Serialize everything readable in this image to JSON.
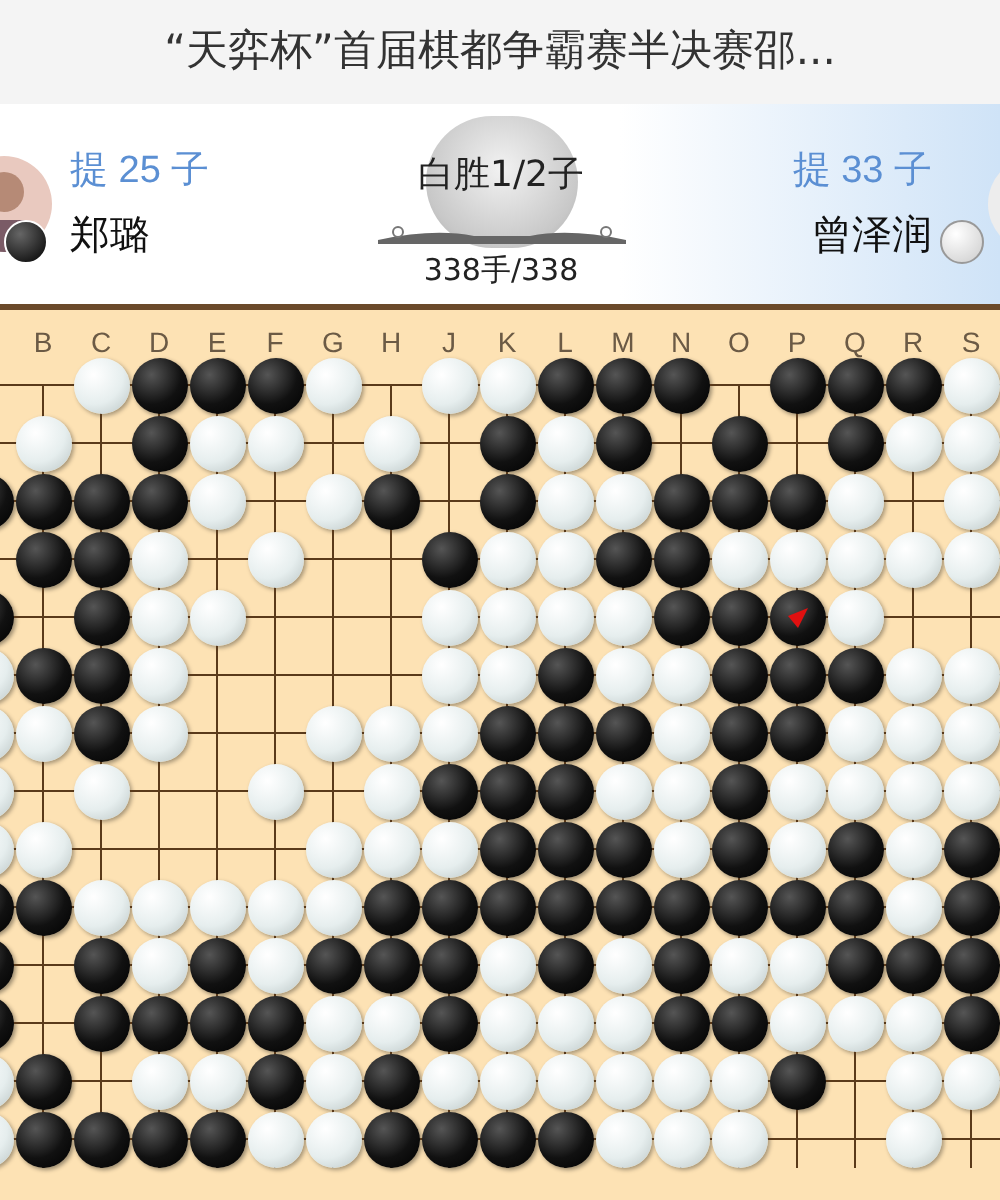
{
  "title": "“天弈杯”首届棋都争霸赛半决赛邵...",
  "black_player": {
    "captures": "提 25 子",
    "name": "郑璐"
  },
  "white_player": {
    "captures": "提 33 子",
    "name": "曾泽润"
  },
  "result": "白胜1/2子",
  "move_counter": "338手/338",
  "board": {
    "column_labels": [
      "B",
      "C",
      "D",
      "E",
      "F",
      "G",
      "H",
      "J",
      "K",
      "L",
      "M",
      "N",
      "O",
      "P",
      "Q",
      "R",
      "S"
    ],
    "rows": [
      [
        {
          "kind": "empty"
        },
        {
          "kind": "empty"
        },
        {
          "kind": "white"
        },
        {
          "kind": "black"
        },
        {
          "kind": "black"
        },
        {
          "kind": "black"
        },
        {
          "kind": "white"
        },
        {
          "kind": "empty"
        },
        {
          "kind": "white"
        },
        {
          "kind": "white"
        },
        {
          "kind": "black"
        },
        {
          "kind": "black"
        },
        {
          "kind": "black"
        },
        {
          "kind": "empty"
        },
        {
          "kind": "black"
        },
        {
          "kind": "black"
        },
        {
          "kind": "black"
        },
        {
          "kind": "white"
        }
      ],
      [
        {
          "kind": "empty"
        },
        {
          "kind": "white"
        },
        {
          "kind": "empty"
        },
        {
          "kind": "black"
        },
        {
          "kind": "white"
        },
        {
          "kind": "white"
        },
        {
          "kind": "empty"
        },
        {
          "kind": "white"
        },
        {
          "kind": "empty"
        },
        {
          "kind": "black"
        },
        {
          "kind": "white"
        },
        {
          "kind": "black"
        },
        {
          "kind": "empty"
        },
        {
          "kind": "black"
        },
        {
          "kind": "empty"
        },
        {
          "kind": "black"
        },
        {
          "kind": "white"
        },
        {
          "kind": "white"
        }
      ],
      [
        {
          "kind": "black"
        },
        {
          "kind": "black"
        },
        {
          "kind": "black"
        },
        {
          "kind": "black"
        },
        {
          "kind": "white"
        },
        {
          "kind": "empty"
        },
        {
          "kind": "white"
        },
        {
          "kind": "black"
        },
        {
          "kind": "empty"
        },
        {
          "kind": "black"
        },
        {
          "kind": "white"
        },
        {
          "kind": "white"
        },
        {
          "kind": "black"
        },
        {
          "kind": "black"
        },
        {
          "kind": "black"
        },
        {
          "kind": "white"
        },
        {
          "kind": "empty"
        },
        {
          "kind": "white"
        }
      ],
      [
        {
          "kind": "empty"
        },
        {
          "kind": "black"
        },
        {
          "kind": "black"
        },
        {
          "kind": "white"
        },
        {
          "kind": "empty"
        },
        {
          "kind": "white"
        },
        {
          "kind": "empty"
        },
        {
          "kind": "empty"
        },
        {
          "kind": "black"
        },
        {
          "kind": "white"
        },
        {
          "kind": "white"
        },
        {
          "kind": "black"
        },
        {
          "kind": "black"
        },
        {
          "kind": "white"
        },
        {
          "kind": "white"
        },
        {
          "kind": "white"
        },
        {
          "kind": "white"
        },
        {
          "kind": "white"
        }
      ],
      [
        {
          "kind": "black"
        },
        {
          "kind": "empty"
        },
        {
          "kind": "black"
        },
        {
          "kind": "white"
        },
        {
          "kind": "white"
        },
        {
          "kind": "empty"
        },
        {
          "kind": "empty"
        },
        {
          "kind": "empty"
        },
        {
          "kind": "white"
        },
        {
          "kind": "white"
        },
        {
          "kind": "white"
        },
        {
          "kind": "white"
        },
        {
          "kind": "black"
        },
        {
          "kind": "black"
        },
        {
          "kind": "marked"
        },
        {
          "kind": "white"
        },
        {
          "kind": "empty"
        },
        {
          "kind": "empty"
        }
      ],
      [
        {
          "kind": "white"
        },
        {
          "kind": "black"
        },
        {
          "kind": "black"
        },
        {
          "kind": "white"
        },
        {
          "kind": "empty"
        },
        {
          "kind": "empty"
        },
        {
          "kind": "empty"
        },
        {
          "kind": "empty"
        },
        {
          "kind": "white"
        },
        {
          "kind": "white"
        },
        {
          "kind": "black"
        },
        {
          "kind": "white"
        },
        {
          "kind": "white"
        },
        {
          "kind": "black"
        },
        {
          "kind": "black"
        },
        {
          "kind": "black"
        },
        {
          "kind": "white"
        },
        {
          "kind": "white"
        }
      ],
      [
        {
          "kind": "white"
        },
        {
          "kind": "white"
        },
        {
          "kind": "black"
        },
        {
          "kind": "white"
        },
        {
          "kind": "empty"
        },
        {
          "kind": "empty"
        },
        {
          "kind": "white"
        },
        {
          "kind": "white"
        },
        {
          "kind": "white"
        },
        {
          "kind": "black"
        },
        {
          "kind": "black"
        },
        {
          "kind": "black"
        },
        {
          "kind": "white"
        },
        {
          "kind": "black"
        },
        {
          "kind": "black"
        },
        {
          "kind": "white"
        },
        {
          "kind": "white"
        },
        {
          "kind": "white"
        }
      ],
      [
        {
          "kind": "white"
        },
        {
          "kind": "empty"
        },
        {
          "kind": "white"
        },
        {
          "kind": "empty"
        },
        {
          "kind": "empty"
        },
        {
          "kind": "white"
        },
        {
          "kind": "empty"
        },
        {
          "kind": "white"
        },
        {
          "kind": "black"
        },
        {
          "kind": "black"
        },
        {
          "kind": "black"
        },
        {
          "kind": "white"
        },
        {
          "kind": "white"
        },
        {
          "kind": "black"
        },
        {
          "kind": "white"
        },
        {
          "kind": "white"
        },
        {
          "kind": "white"
        },
        {
          "kind": "white"
        }
      ],
      [
        {
          "kind": "white"
        },
        {
          "kind": "white"
        },
        {
          "kind": "empty"
        },
        {
          "kind": "empty"
        },
        {
          "kind": "empty"
        },
        {
          "kind": "empty"
        },
        {
          "kind": "white"
        },
        {
          "kind": "white"
        },
        {
          "kind": "white"
        },
        {
          "kind": "black"
        },
        {
          "kind": "black"
        },
        {
          "kind": "black"
        },
        {
          "kind": "white"
        },
        {
          "kind": "black"
        },
        {
          "kind": "white"
        },
        {
          "kind": "black"
        },
        {
          "kind": "white"
        },
        {
          "kind": "black"
        }
      ],
      [
        {
          "kind": "black"
        },
        {
          "kind": "black"
        },
        {
          "kind": "white"
        },
        {
          "kind": "white"
        },
        {
          "kind": "white"
        },
        {
          "kind": "white"
        },
        {
          "kind": "white"
        },
        {
          "kind": "black"
        },
        {
          "kind": "black"
        },
        {
          "kind": "black"
        },
        {
          "kind": "black"
        },
        {
          "kind": "black"
        },
        {
          "kind": "black"
        },
        {
          "kind": "black"
        },
        {
          "kind": "black"
        },
        {
          "kind": "black"
        },
        {
          "kind": "white"
        },
        {
          "kind": "black"
        }
      ],
      [
        {
          "kind": "black"
        },
        {
          "kind": "empty"
        },
        {
          "kind": "black"
        },
        {
          "kind": "white"
        },
        {
          "kind": "black"
        },
        {
          "kind": "white"
        },
        {
          "kind": "black"
        },
        {
          "kind": "black"
        },
        {
          "kind": "black"
        },
        {
          "kind": "white"
        },
        {
          "kind": "black"
        },
        {
          "kind": "white"
        },
        {
          "kind": "black"
        },
        {
          "kind": "white"
        },
        {
          "kind": "white"
        },
        {
          "kind": "black"
        },
        {
          "kind": "black"
        },
        {
          "kind": "black"
        }
      ],
      [
        {
          "kind": "black"
        },
        {
          "kind": "empty"
        },
        {
          "kind": "black"
        },
        {
          "kind": "black"
        },
        {
          "kind": "black"
        },
        {
          "kind": "black"
        },
        {
          "kind": "white"
        },
        {
          "kind": "white"
        },
        {
          "kind": "black"
        },
        {
          "kind": "white"
        },
        {
          "kind": "white"
        },
        {
          "kind": "white"
        },
        {
          "kind": "black"
        },
        {
          "kind": "black"
        },
        {
          "kind": "white"
        },
        {
          "kind": "white"
        },
        {
          "kind": "white"
        },
        {
          "kind": "black"
        }
      ],
      [
        {
          "kind": "white"
        },
        {
          "kind": "black"
        },
        {
          "kind": "empty"
        },
        {
          "kind": "white"
        },
        {
          "kind": "white"
        },
        {
          "kind": "black"
        },
        {
          "kind": "white"
        },
        {
          "kind": "black"
        },
        {
          "kind": "white"
        },
        {
          "kind": "white"
        },
        {
          "kind": "white"
        },
        {
          "kind": "white"
        },
        {
          "kind": "white"
        },
        {
          "kind": "white"
        },
        {
          "kind": "black"
        },
        {
          "kind": "empty"
        },
        {
          "kind": "white"
        },
        {
          "kind": "white"
        }
      ],
      [
        {
          "kind": "white"
        },
        {
          "kind": "black"
        },
        {
          "kind": "black"
        },
        {
          "kind": "black"
        },
        {
          "kind": "black"
        },
        {
          "kind": "white"
        },
        {
          "kind": "white"
        },
        {
          "kind": "black"
        },
        {
          "kind": "black"
        },
        {
          "kind": "black"
        },
        {
          "kind": "black"
        },
        {
          "kind": "white"
        },
        {
          "kind": "white"
        },
        {
          "kind": "white"
        },
        {
          "kind": "empty"
        },
        {
          "kind": "empty"
        },
        {
          "kind": "white"
        },
        {
          "kind": "empty"
        }
      ]
    ]
  }
}
